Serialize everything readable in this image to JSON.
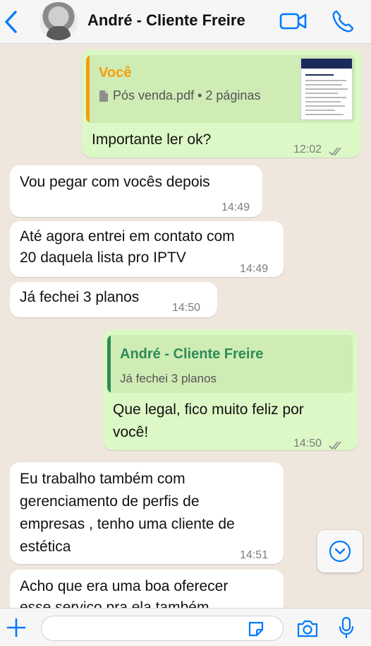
{
  "header": {
    "title": "André - Cliente Freire"
  },
  "messages": {
    "m1": {
      "quote_name": "Você",
      "file_name": "Pós venda.pdf • 2 páginas",
      "text": "Importante ler ok?",
      "time": "12:02"
    },
    "m2": {
      "text": "Vou pegar com vocês depois",
      "time": "14:49"
    },
    "m3": {
      "line1": "Até agora entrei em contato com",
      "line2": "20 daquela lista pro IPTV",
      "time": "14:49"
    },
    "m4": {
      "text": "Já fechei 3 planos",
      "time": "14:50"
    },
    "m5": {
      "quote_name": "André - Cliente Freire",
      "quote_text": "Já fechei 3 planos",
      "line1": "Que legal, fico muito feliz por",
      "line2": "você!",
      "time": "14:50"
    },
    "m6": {
      "line1": "Eu trabalho também com",
      "line2": "gerenciamento de perfis de",
      "line3": "empresas , tenho uma cliente de",
      "line4": "estética",
      "time": "14:51"
    },
    "m7": {
      "line1": "Acho que era uma boa oferecer",
      "line2": "esse serviço pra ela também"
    }
  },
  "composer": {
    "placeholder": ""
  },
  "colors": {
    "accent": "#007aff",
    "outgoing_bubble": "#dcf8c6",
    "incoming_bubble": "#ffffff",
    "quote_self": "#f59e0b",
    "quote_contact": "#2e8b57",
    "background": "#efe7de"
  },
  "icons": [
    "back-chevron-icon",
    "video-call-icon",
    "phone-icon",
    "pdf-file-icon",
    "double-check-icon",
    "chevron-down-icon",
    "plus-icon",
    "sticker-icon",
    "camera-icon",
    "microphone-icon"
  ]
}
